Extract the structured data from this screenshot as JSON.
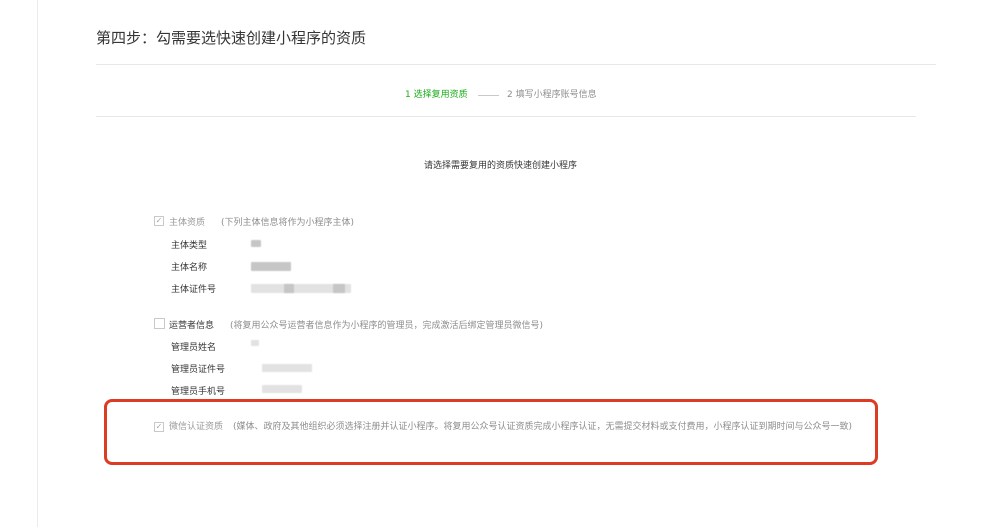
{
  "page": {
    "title": "第四步：勾需要选快速创建小程序的资质"
  },
  "steps": {
    "step1": "1 选择复用资质",
    "step2": "2 填写小程序账号信息"
  },
  "instruction": "请选择需要复用的资质快速创建小程序",
  "subject": {
    "checkbox_mark": "✓",
    "label": "主体资质",
    "note": "(下列主体信息将作为小程序主体)",
    "fields": [
      "主体类型",
      "主体名称",
      "主体证件号"
    ]
  },
  "operator": {
    "label": "运营者信息",
    "note": "(将复用公众号运营者信息作为小程序的管理员，完成激活后绑定管理员微信号)",
    "fields": [
      "管理员姓名",
      "管理员证件号",
      "管理员手机号"
    ]
  },
  "wechat_cert": {
    "checkbox_mark": "✓",
    "label": "微信认证资质",
    "note": "(媒体、政府及其他组织必须选择注册并认证小程序。将复用公众号认证资质完成小程序认证，无需提交材料或支付费用，小程序认证到期时间与公众号一致)"
  },
  "colors": {
    "active_step": "#1aad19",
    "highlight_border": "#db3c22",
    "muted_text": "#8d8d8d"
  }
}
